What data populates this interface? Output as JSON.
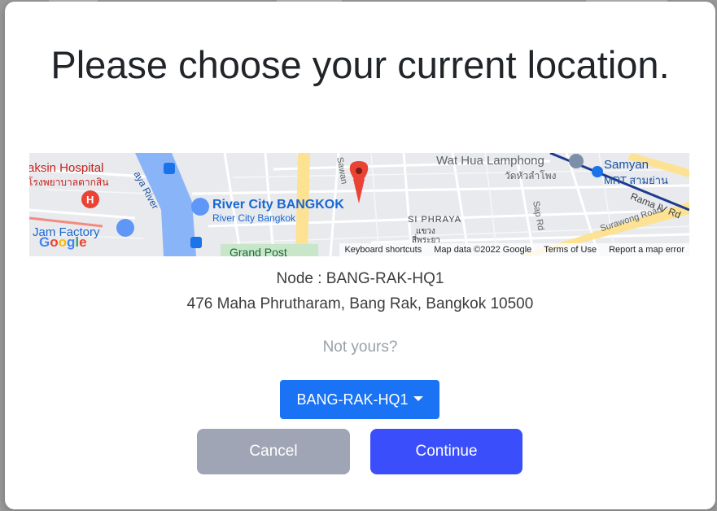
{
  "modal": {
    "title": "Please choose your current location."
  },
  "map": {
    "labels": {
      "hospital": "aksin Hospital",
      "hospital_thai": "โรงพยาบาลตากสิน",
      "river": "aya River",
      "river_city": "River City BANGKOK",
      "river_city_sub": "River City Bangkok",
      "jam_factory": "Jam Factory",
      "grand_post": "Grand Post",
      "wat_hua_lamphong": "Wat Hua Lamphong",
      "wat_hua_lamphong_thai": "วัดหัวลำโพง",
      "samyan": "Samyan",
      "samyan_mrt": "MRT สามย่าน",
      "rama_iv": "Rama IV Rd",
      "surawong": "Surawong Road",
      "si_phraya": "SI PHRAYA",
      "si_phraya_thai1": "แขวง",
      "si_phraya_thai2": "สี่พระยา",
      "sap_rd": "Sap Rd",
      "sawan": "Sawan"
    },
    "google_logo": "Google",
    "footer": {
      "keyboard": "Keyboard shortcuts",
      "map_data": "Map data ©2022 Google",
      "terms": "Terms of Use",
      "report": "Report a map error"
    },
    "colors": {
      "water": "#8ab4f8",
      "park": "#c8e6c9",
      "road_major": "#fde293",
      "marker": "#ea4335"
    }
  },
  "location": {
    "node_line": "Node : BANG-RAK-HQ1",
    "address": "476 Maha Phrutharam, Bang Rak, Bangkok 10500"
  },
  "not_yours": "Not yours?",
  "selector": {
    "value": "BANG-RAK-HQ1"
  },
  "buttons": {
    "cancel": "Cancel",
    "continue": "Continue"
  }
}
